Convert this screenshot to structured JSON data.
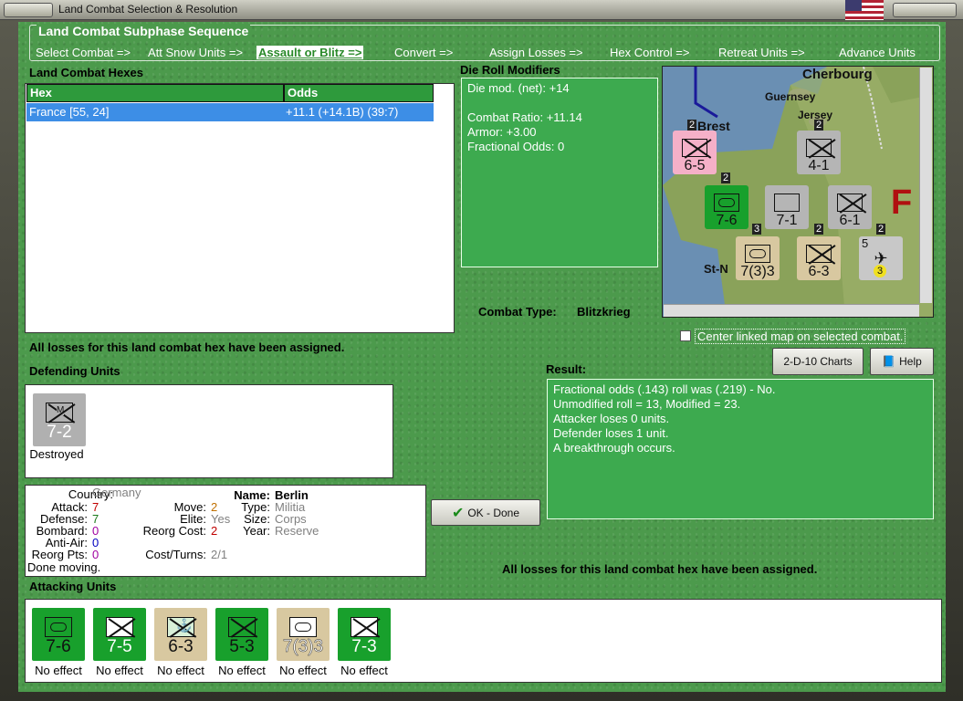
{
  "window": {
    "title": "Land Combat Selection & Resolution"
  },
  "sequence": {
    "title": "Land Combat Subphase Sequence",
    "items": [
      "Select Combat =>",
      "Att Snow Units =>",
      "Assault or Blitz =>",
      "Convert =>",
      "Assign Losses =>",
      "Hex Control =>",
      "Retreat Units =>",
      "Advance Units"
    ],
    "active_index": 2
  },
  "hexes": {
    "section_label": "Land Combat Hexes",
    "columns": [
      "Hex",
      "Odds"
    ],
    "rows": [
      {
        "hex": "France [55, 24]",
        "odds": "+11.1 (+14.1B) (39:7)"
      }
    ]
  },
  "die_roll": {
    "label": "Die Roll Modifiers",
    "lines": [
      "Die mod. (net): +14",
      "",
      "Combat Ratio: +11.14",
      "Armor: +3.00",
      "Fractional Odds: 0"
    ]
  },
  "map": {
    "places": [
      "Cherbourg",
      "Guernsey",
      "Jersey",
      "Brest",
      "St-N"
    ],
    "nation_letter": "F",
    "counters": [
      {
        "label": "6-5",
        "stack": "2",
        "color": "#f5b0c8"
      },
      {
        "label": "4-1",
        "stack": "2",
        "color": "#b5b5b5"
      },
      {
        "label": "7-6",
        "stack": "2",
        "color": "#18a02c"
      },
      {
        "label": "7-1",
        "stack": "",
        "color": "#b5b5b5"
      },
      {
        "label": "6-1",
        "stack": "",
        "color": "#b5b5b5"
      },
      {
        "label": "7(3)3",
        "stack": "3",
        "color": "#d8c8a0"
      },
      {
        "label": "6-3",
        "stack": "2",
        "color": "#d8c8a0"
      },
      {
        "label": "5",
        "stack": "2",
        "color": "#c8c8c8"
      }
    ],
    "air_strength": "3"
  },
  "combat_type": {
    "label": "Combat Type:",
    "value": "Blitzkrieg"
  },
  "center_map": {
    "label": "Center linked map on selected combat."
  },
  "buttons": {
    "charts": "2-D-10 Charts",
    "help": "Help",
    "ok": "OK - Done"
  },
  "losses_msg": "All losses for this land combat hex have been assigned.",
  "defending": {
    "label": "Defending Units",
    "units": [
      {
        "value": "7-2",
        "letter": "M",
        "status": "Destroyed",
        "color": "#b0b0b0"
      }
    ]
  },
  "unit_info": {
    "country_k": "Country:",
    "country": "Germany",
    "attack_k": "Attack:",
    "attack": "7",
    "defense_k": "Defense:",
    "defense": "7",
    "bombard_k": "Bombard:",
    "bombard": "0",
    "antiair_k": "Anti-Air:",
    "antiair": "0",
    "reorgpts_k": "Reorg Pts:",
    "reorgpts": "0",
    "done": "Done moving.",
    "move_k": "Move:",
    "move": "2",
    "elite_k": "Elite:",
    "elite": "Yes",
    "reorgcost_k": "Reorg Cost:",
    "reorgcost": "2",
    "costturns_k": "Cost/Turns:",
    "costturns": "2/1",
    "name_k": "Name:",
    "name": "Berlin",
    "type_k": "Type:",
    "type": "Militia",
    "size_k": "Size:",
    "size": "Corps",
    "year_k": "Year:",
    "year": "Reserve"
  },
  "result": {
    "label": "Result:",
    "lines": [
      "Fractional odds (.143) roll was (.219)  - No.",
      "Unmodified roll = 13, Modified = 23.",
      "Attacker loses 0 units.",
      "Defender loses 1 unit.",
      "A breakthrough occurs."
    ]
  },
  "attacking": {
    "label": "Attacking Units",
    "units": [
      {
        "value": "7-6",
        "status": "No effect",
        "color": "#18a02c",
        "sym": "armor"
      },
      {
        "value": "7-5",
        "status": "No effect",
        "color": "#18a02c",
        "sym": "infantry"
      },
      {
        "value": "6-3",
        "status": "No effect",
        "color": "#d8c8a0",
        "sym": "marine"
      },
      {
        "value": "5-3",
        "status": "No effect",
        "color": "#18a02c",
        "sym": "infantry"
      },
      {
        "value": "7(3)3",
        "status": "No effect",
        "color": "#d8c8a0",
        "sym": "armor"
      },
      {
        "value": "7-3",
        "status": "No effect",
        "color": "#18a02c",
        "sym": "infantry"
      }
    ]
  },
  "colors": {
    "panel_green": "#3daa4f",
    "selection_blue": "#3d8ee6",
    "grey_text": "#808080",
    "red_value": "#c00000",
    "green_value": "#1a7a1a",
    "purple_value": "#a000a0",
    "orange_value": "#c07000"
  }
}
